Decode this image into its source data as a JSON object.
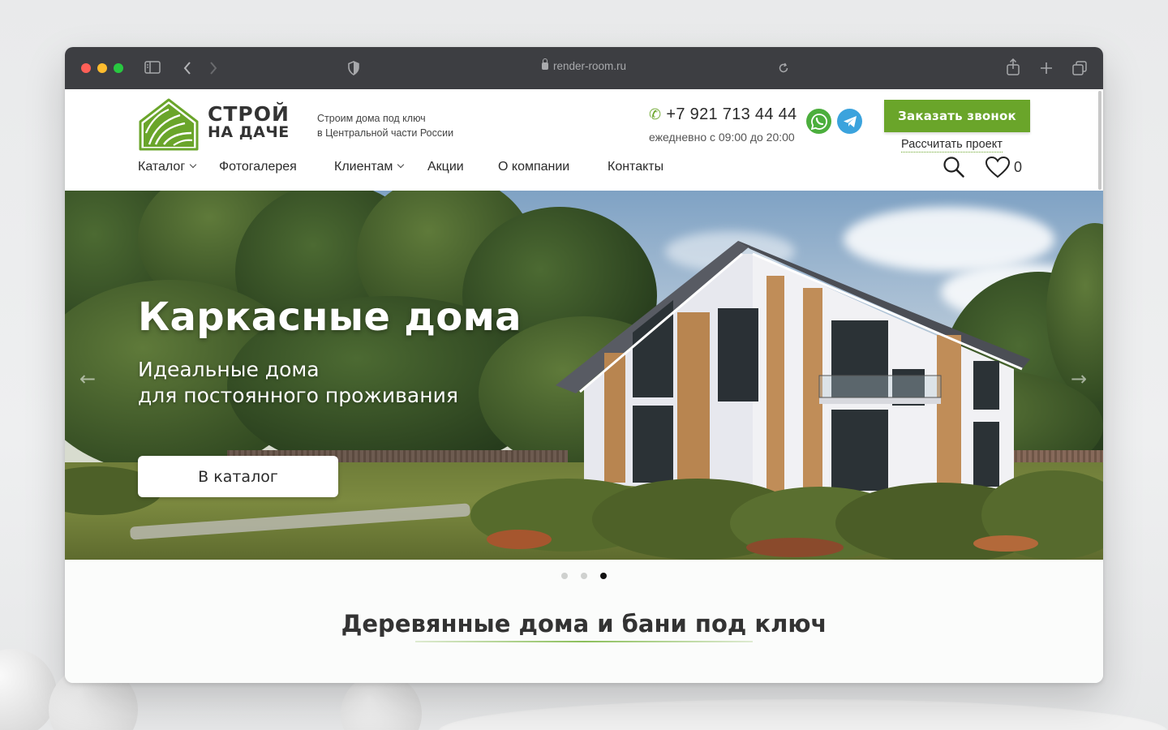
{
  "browser": {
    "url": "render-room.ru",
    "traffic_colors": [
      "#ff5f57",
      "#febc2e",
      "#28c840"
    ]
  },
  "header": {
    "brand_line1": "СТРОЙ",
    "brand_line2": "НА ДАЧЕ",
    "tagline_line1": "Строим дома под ключ",
    "tagline_line2": "в Центральной части России",
    "phone": "+7 921 713 44 44",
    "hours": "ежедневно с 09:00 до 20:00",
    "call_button": "Заказать звонок",
    "calc_link": "Рассчитать проект",
    "favorites_count": "0",
    "accent_color": "#6aa52a"
  },
  "nav": {
    "items": [
      {
        "label": "Каталог"
      },
      {
        "label": "Фотогалерея"
      },
      {
        "label": "Клиентам"
      },
      {
        "label": "Акции"
      },
      {
        "label": "О компании"
      },
      {
        "label": "Контакты"
      }
    ]
  },
  "hero": {
    "title": "Каркасные дома",
    "subtitle_line1": "Идеальные дома",
    "subtitle_line2": "для постоянного проживания",
    "button": "В каталог",
    "slides_total": 3,
    "active_slide": 3
  },
  "section": {
    "title": "Деревянные дома и бани под ключ"
  }
}
